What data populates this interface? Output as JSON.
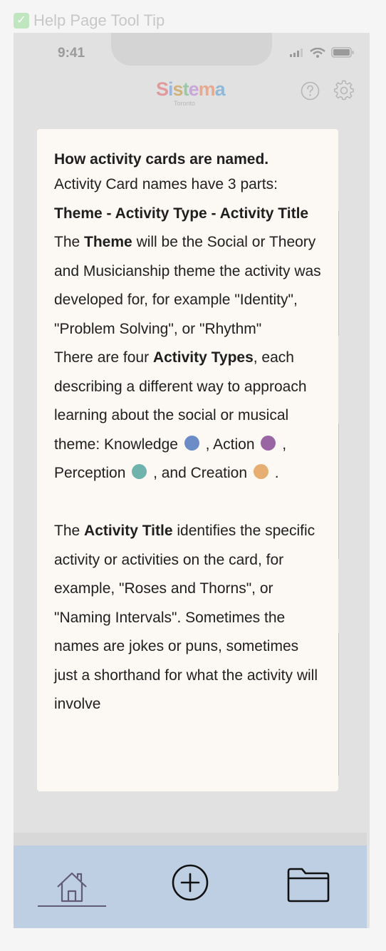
{
  "frame": {
    "check": "✅",
    "title": "Help Page Tool Tip"
  },
  "status_bar": {
    "time": "9:41"
  },
  "header": {
    "logo": "Sistema",
    "subtitle": "Toronto",
    "help_icon": "question-circle-icon",
    "settings_icon": "gear-icon"
  },
  "tooltip": {
    "heading": "How activity cards are named.",
    "intro": "Activity Card names have 3 parts:",
    "pattern": "Theme - Activity Type - Activity Title",
    "theme": {
      "prefix": "The",
      "bold": "Theme",
      "rest": "will be the Social or Theory and Musicianship theme the activity was developed for, for example \"Identity\", \"Problem Solving\", or \"Rhythm\""
    },
    "types": {
      "prefix": "There are four",
      "bold": "Activity Types",
      "rest": ", each describing a different way to approach learning about the social or musical theme:",
      "items": [
        {
          "label": "Knowledge",
          "color": "#6b8cc6",
          "suffix": " ,"
        },
        {
          "label": "Action",
          "color": "#9a65a3",
          "suffix": " ,"
        },
        {
          "label": "Perception",
          "color": "#6fb3ad",
          "suffix": " , and"
        },
        {
          "label": "Creation",
          "color": "#e7ae72",
          "suffix": " ."
        }
      ]
    },
    "title": {
      "prefix": "The",
      "bold": "Activity Title",
      "rest": "identifies the specific activity or activities on the card, for example, \"Roses and Thorns\", or \"Naming Intervals\". Sometimes the names are jokes or puns, sometimes just a shorthand for what the activity will involve"
    }
  },
  "tab_bar": {
    "home_icon": "home-icon",
    "add_icon": "plus-circle-icon",
    "folder_icon": "folder-icon"
  },
  "colors": {
    "tab_bar": "#bfcfe3",
    "overlay": "#e1e1e1",
    "tooltip": "#fcf9f5",
    "logo_letters": [
      "#df9b9b",
      "#9cb8de",
      "#cfb37b",
      "#9bc9a7",
      "#c7a6d8",
      "#e9a98e",
      "#8fb8d9"
    ]
  }
}
